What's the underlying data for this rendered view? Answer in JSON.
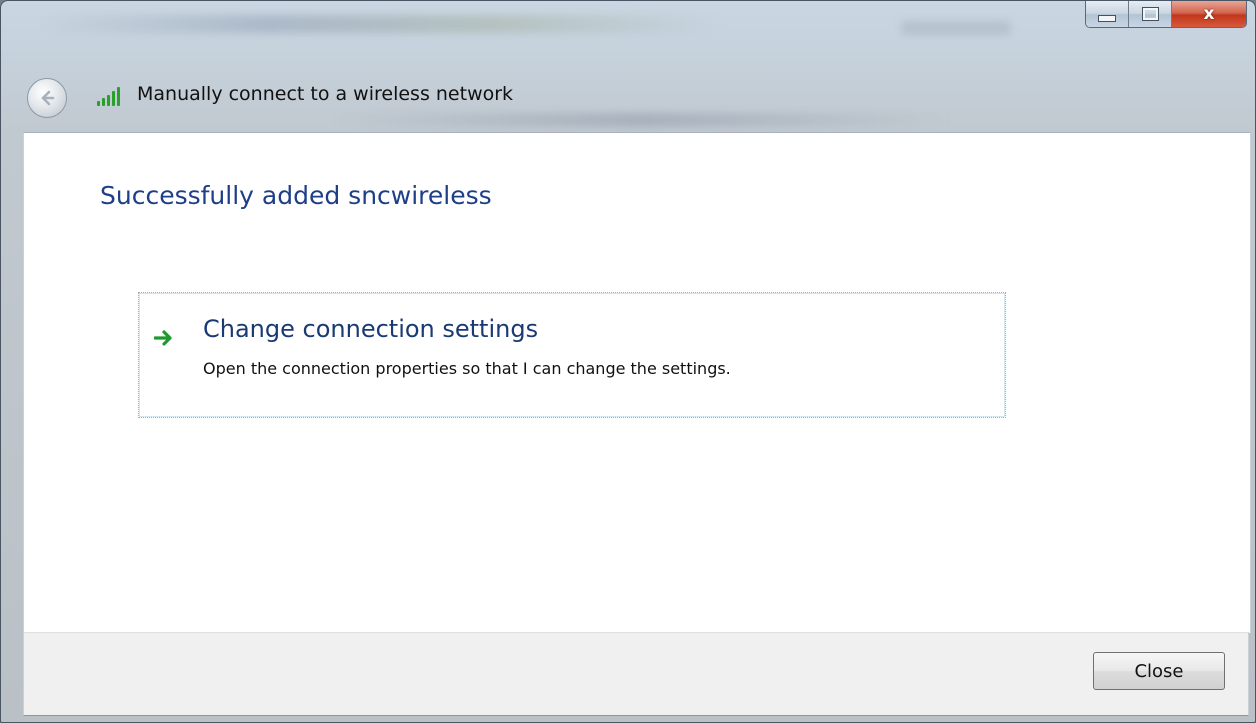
{
  "window": {
    "caption_buttons": {
      "close_glyph": "x"
    },
    "title": "Manually connect to a wireless network"
  },
  "content": {
    "heading": "Successfully added sncwireless",
    "command_link": {
      "title": "Change connection settings",
      "description": "Open the connection properties so that I can change the settings."
    }
  },
  "footer": {
    "close_label": "Close"
  },
  "icons": {
    "back": "back-arrow-icon",
    "signal": "wifi-signal-icon",
    "command": "green-arrow-icon"
  },
  "colors": {
    "heading": "#1e3f87",
    "link_title": "#1a3a73",
    "signal": "#2aa02a",
    "arrow": "#1f9a2f",
    "close_button_red": "#c2371c"
  }
}
